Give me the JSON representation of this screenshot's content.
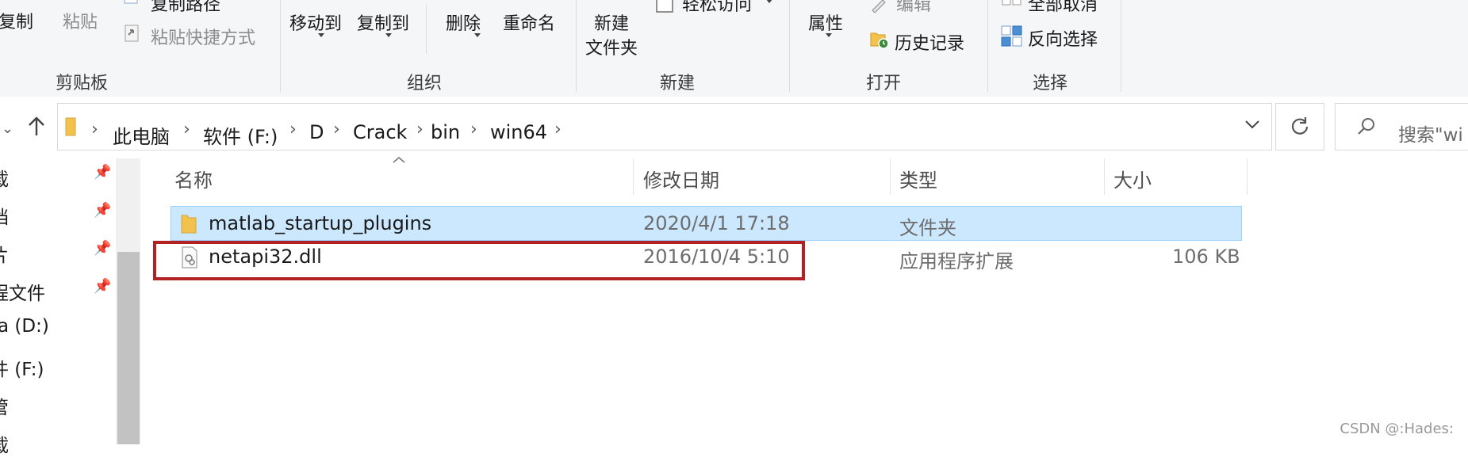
{
  "ribbon": {
    "copy": "复制",
    "paste": "粘贴",
    "copy_path": "复制路径",
    "paste_shortcut": "粘贴快捷方式",
    "move_to": "移动到",
    "copy_to": "复制到",
    "delete": "删除",
    "rename": "重命名",
    "new_folder_l1": "新建",
    "new_folder_l2": "文件夹",
    "easy_access": "轻松访问",
    "properties": "属性",
    "edit": "编辑",
    "history": "历史记录",
    "select_none": "全部取消",
    "invert_selection": "反向选择",
    "groups": {
      "clipboard": "剪贴板",
      "organize": "组织",
      "new": "新建",
      "open": "打开",
      "select": "选择"
    }
  },
  "address": {
    "crumbs": [
      "此电脑",
      "软件 (F:)",
      "D",
      "Crack",
      "bin",
      "win64"
    ],
    "search_placeholder": "搜索\"wi"
  },
  "nav": {
    "items": [
      "载",
      "档",
      "片",
      "程文件",
      "ta (D:)",
      "件 (F:)",
      "管",
      "载"
    ]
  },
  "columns": {
    "name": "名称",
    "date": "修改日期",
    "type": "类型",
    "size": "大小"
  },
  "files": [
    {
      "name": "matlab_startup_plugins",
      "date": "2020/4/1 17:18",
      "type": "文件夹",
      "size": "",
      "icon": "folder-icon"
    },
    {
      "name": "netapi32.dll",
      "date": "2016/10/4 5:10",
      "type": "应用程序扩展",
      "size": "106 KB",
      "icon": "dll-file-icon"
    }
  ],
  "watermark": "CSDN @:Hades:",
  "colors": {
    "selection_bg": "#cce8ff",
    "selection_border": "#99d1ff",
    "highlight_box": "#b22222",
    "folder_yellow": "#f2c14e"
  }
}
